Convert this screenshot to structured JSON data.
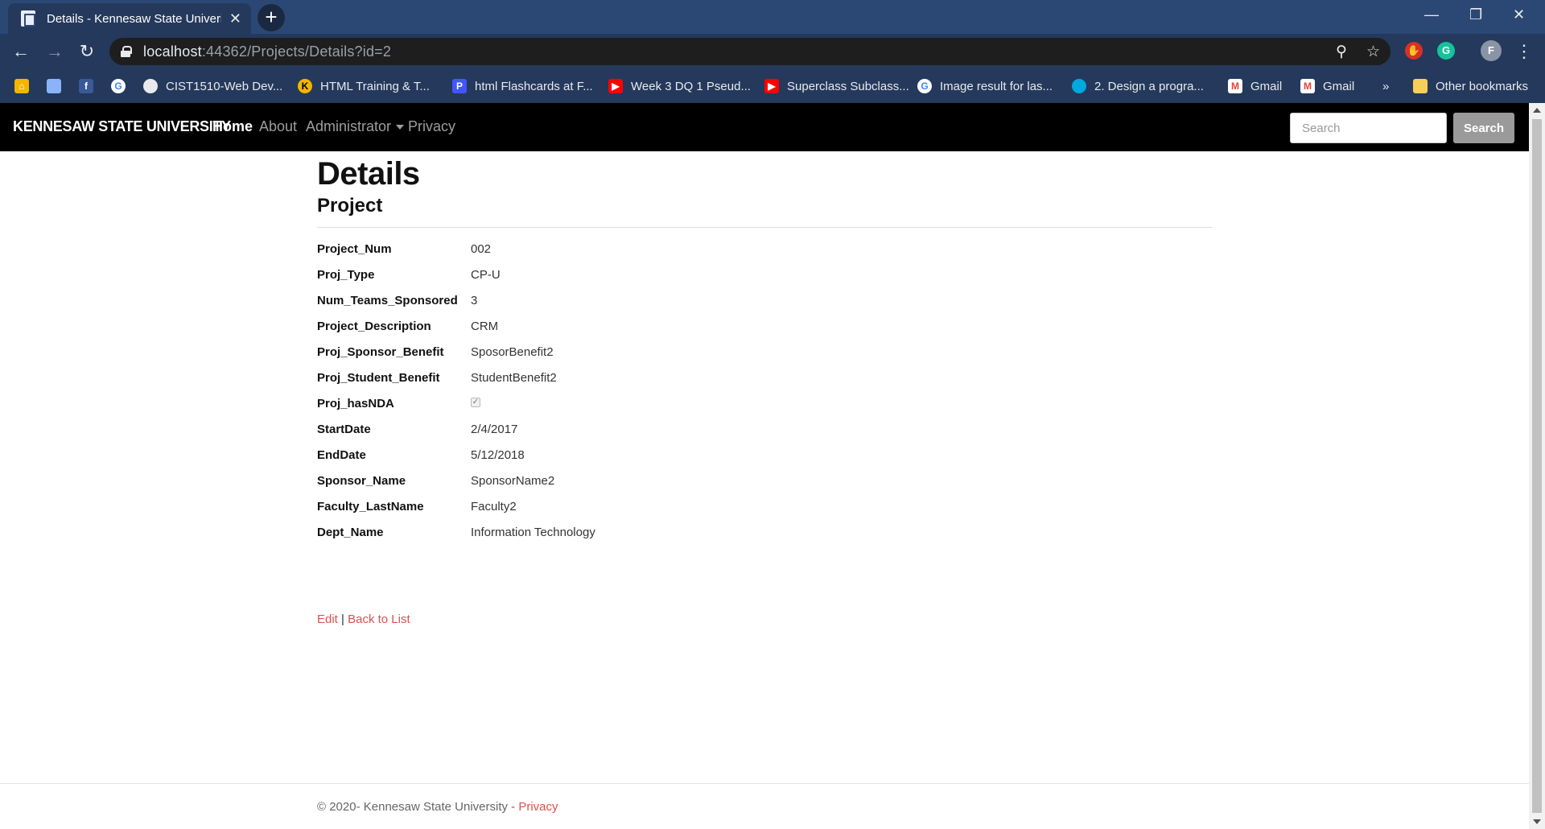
{
  "browser": {
    "tab_title": "Details - Kennesaw State Univeris",
    "url_host": "localhost",
    "url_rest": ":44362/Projects/Details?id=2",
    "bookmarks": [
      {
        "label": "",
        "icon": "home-icon",
        "color": "#f4b400"
      },
      {
        "label": "",
        "icon": "bookmark-icon",
        "color": "#8ab4f8"
      },
      {
        "label": "",
        "icon": "facebook-icon",
        "color": "#3b5998"
      },
      {
        "label": "",
        "icon": "google-icon",
        "color": "#ffffff"
      },
      {
        "label": "CIST1510-Web Dev...",
        "icon": "web-icon",
        "color": "#e8eaed"
      },
      {
        "label": "HTML Training & T...",
        "icon": "ksu-icon",
        "color": "#f4b400"
      },
      {
        "label": "html Flashcards at F...",
        "icon": "quizlet-icon",
        "color": "#4255ff"
      },
      {
        "label": "Week 3 DQ 1 Pseud...",
        "icon": "youtube-icon",
        "color": "#ff0000"
      },
      {
        "label": "Superclass Subclass...",
        "icon": "youtube-icon",
        "color": "#ff0000"
      },
      {
        "label": "Image result for las...",
        "icon": "google-icon",
        "color": "#ffffff"
      },
      {
        "label": "2. Design a progra...",
        "icon": "att-icon",
        "color": "#00a8e0"
      },
      {
        "label": "Gmail",
        "icon": "gmail-icon",
        "color": "#ea4335"
      },
      {
        "label": "Gmail",
        "icon": "gmail-icon",
        "color": "#ea4335"
      }
    ],
    "overflow_label": "»",
    "other_bookmarks": "Other bookmarks",
    "profile_initial": "F"
  },
  "site": {
    "brand": "KENNESAW STATE UNIVERSITY",
    "nav": {
      "home": "Home",
      "about": "About",
      "administrator": "Administrator",
      "privacy": "Privacy"
    },
    "search_placeholder": "Search",
    "search_button": "Search"
  },
  "page": {
    "title": "Details",
    "subtitle": "Project",
    "fields": [
      {
        "label": "Project_Num",
        "value": "002"
      },
      {
        "label": "Proj_Type",
        "value": "CP-U"
      },
      {
        "label": "Num_Teams_Sponsored",
        "value": "3"
      },
      {
        "label": "Project_Description",
        "value": "CRM"
      },
      {
        "label": "Proj_Sponsor_Benefit",
        "value": "SposorBenefit2"
      },
      {
        "label": "Proj_Student_Benefit",
        "value": "StudentBenefit2"
      },
      {
        "label": "Proj_hasNDA",
        "value": "",
        "checked": true
      },
      {
        "label": "StartDate",
        "value": "2/4/2017"
      },
      {
        "label": "EndDate",
        "value": "5/12/2018"
      },
      {
        "label": "Sponsor_Name",
        "value": "SponsorName2"
      },
      {
        "label": "Faculty_LastName",
        "value": "Faculty2"
      },
      {
        "label": "Dept_Name",
        "value": "Information Technology"
      }
    ],
    "edit_link": "Edit",
    "separator": "|",
    "back_link": "Back to List"
  },
  "footer": {
    "copyright": "© 2020- Kennesaw State University -",
    "privacy_link": "Privacy"
  }
}
